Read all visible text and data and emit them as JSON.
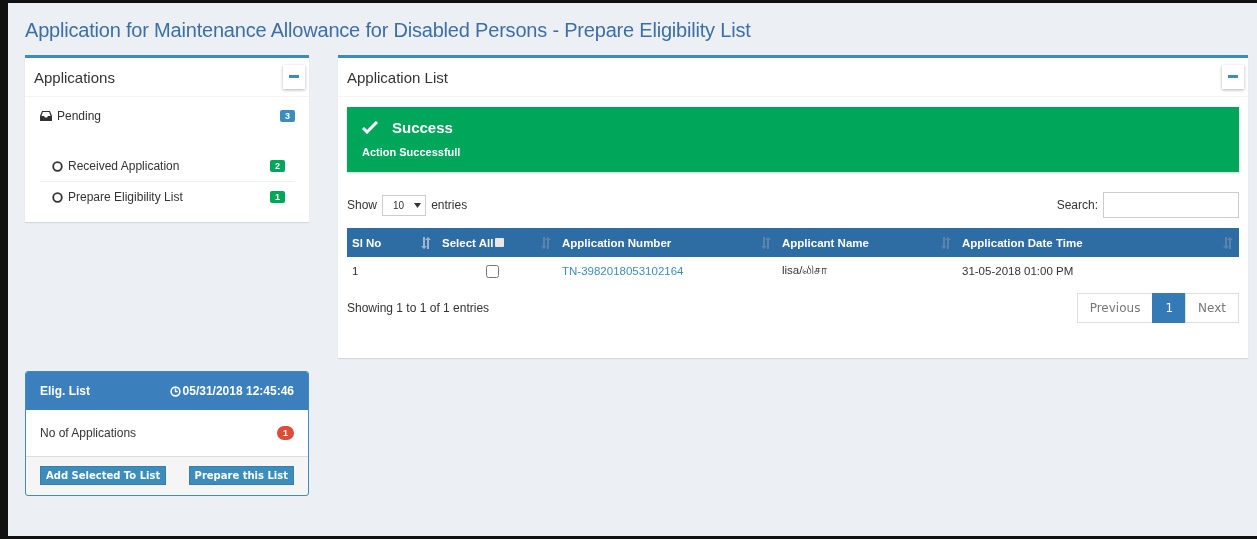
{
  "title": "Application for Maintenance Allowance for Disabled Persons - Prepare Eligibility List",
  "applications": {
    "title": "Applications",
    "group": {
      "label": "Pending",
      "count": "3"
    },
    "items": [
      {
        "label": "Received Application",
        "count": "2"
      },
      {
        "label": "Prepare Eligibility List",
        "count": "1"
      }
    ]
  },
  "elig_list": {
    "title": "Elig. List",
    "timestamp": "05/31/2018 12:45:46",
    "row_label": "No of Applications",
    "row_count": "1",
    "buttons": [
      "Add Selected To List",
      "Prepare this List"
    ]
  },
  "application_list": {
    "title": "Application List",
    "alert": {
      "title": "Success",
      "message": "Action Successfull"
    },
    "show_label": "Show",
    "page_size": "10",
    "entries_label": "entries",
    "search_label": "Search:",
    "columns": [
      {
        "label": "Sl No",
        "kind": "plain"
      },
      {
        "label": "Select All",
        "kind": "select_all"
      },
      {
        "label": "Application Number",
        "kind": "plain"
      },
      {
        "label": "Applicant Name",
        "kind": "plain"
      },
      {
        "label": "Application Date Time",
        "kind": "plain"
      }
    ],
    "rows": [
      {
        "sl_no": "1",
        "checked": false,
        "number": "TN-3982018053102164",
        "name": "lisa/லிசா",
        "date": "31-05-2018 01:00 PM"
      }
    ],
    "info": "Showing 1 to 1 of 1 entries",
    "pagination": [
      {
        "label": "Previous",
        "selected": false
      },
      {
        "label": "1",
        "selected": true
      },
      {
        "label": "Next",
        "selected": false
      }
    ]
  }
}
